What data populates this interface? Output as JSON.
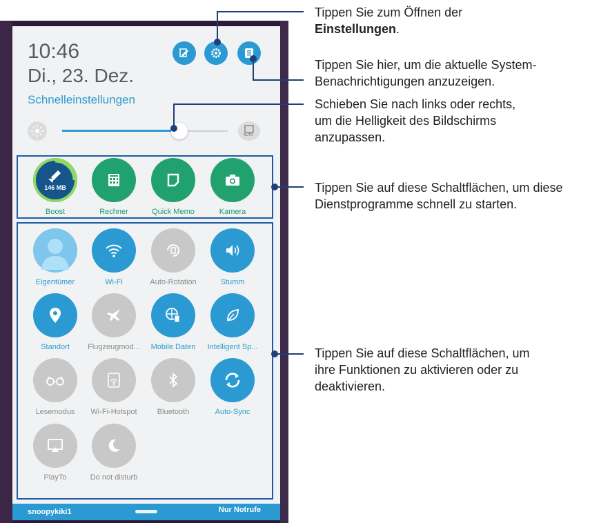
{
  "status": {
    "time": "10:46",
    "date": "Di., 23. Dez.",
    "quick_settings_label": "Schnelleinstellungen"
  },
  "top_icons": [
    "edit-icon",
    "gear-icon",
    "notification-list-icon"
  ],
  "brightness": {
    "level": 0.74,
    "auto_label": "AUTO"
  },
  "shortcuts": [
    {
      "label": "Boost",
      "icon": "broom-icon",
      "sub": "146 MB",
      "color": "#21a16d"
    },
    {
      "label": "Rechner",
      "icon": "calculator-icon",
      "color": "#21a16d"
    },
    {
      "label": "Quick Memo",
      "icon": "memo-icon",
      "color": "#21a16d"
    },
    {
      "label": "Kamera",
      "icon": "camera-icon",
      "color": "#21a16d"
    }
  ],
  "toggles": [
    {
      "label": "Eigentümer",
      "icon": "user-icon",
      "state": "on"
    },
    {
      "label": "Wi-Fi",
      "icon": "wifi-icon",
      "state": "on"
    },
    {
      "label": "Auto-Rotation",
      "icon": "rotation-icon",
      "state": "off"
    },
    {
      "label": "Stumm",
      "icon": "speaker-icon",
      "state": "on"
    },
    {
      "label": "Standort",
      "icon": "location-pin-icon",
      "state": "on"
    },
    {
      "label": "Flugzeugmod...",
      "icon": "airplane-icon",
      "state": "off"
    },
    {
      "label": "Mobile Daten",
      "icon": "globe-icon",
      "state": "on"
    },
    {
      "label": "Intelligent Sp...",
      "icon": "leaf-icon",
      "state": "on"
    },
    {
      "label": "Lesemodus",
      "icon": "glasses-icon",
      "state": "off"
    },
    {
      "label": "Wi-Fi-Hotspot",
      "icon": "hotspot-icon",
      "state": "off"
    },
    {
      "label": "Bluetooth",
      "icon": "bluetooth-icon",
      "state": "off"
    },
    {
      "label": "Auto-Sync",
      "icon": "sync-icon",
      "state": "on"
    },
    {
      "label": "PlayTo",
      "icon": "cast-icon",
      "state": "off"
    },
    {
      "label": "Do not disturb",
      "icon": "moon-icon",
      "state": "off"
    }
  ],
  "bottom_bar": {
    "user": "snoopykiki1",
    "emergency": "Nur Notrufe"
  },
  "callouts": {
    "settings_line1": "Tippen Sie zum Öffnen der",
    "settings_bold": "Einstellungen",
    "settings_end": ".",
    "notifications_line1": "Tippen Sie hier, um die aktuelle System-",
    "notifications_line2": "Benachrichtigungen anzuzeigen.",
    "brightness_line1": "Schieben Sie nach links oder rechts,",
    "brightness_line2": "um die Helligkeit des Bildschirms",
    "brightness_line3": "anzupassen.",
    "shortcuts_line1": "Tippen Sie auf diese Schaltflächen, um diese",
    "shortcuts_line2": "Dienstprogramme schnell zu starten.",
    "toggles_line1": "Tippen Sie auf diese Schaltflächen, um",
    "toggles_line2": "ihre Funktionen zu aktivieren oder zu",
    "toggles_line3": "deaktivieren."
  },
  "colors": {
    "accent_blue": "#2b9ad3",
    "shortcut_green": "#21a16d",
    "disabled_gray": "#c8c8c8",
    "callout_navy": "#1f3e7a"
  }
}
